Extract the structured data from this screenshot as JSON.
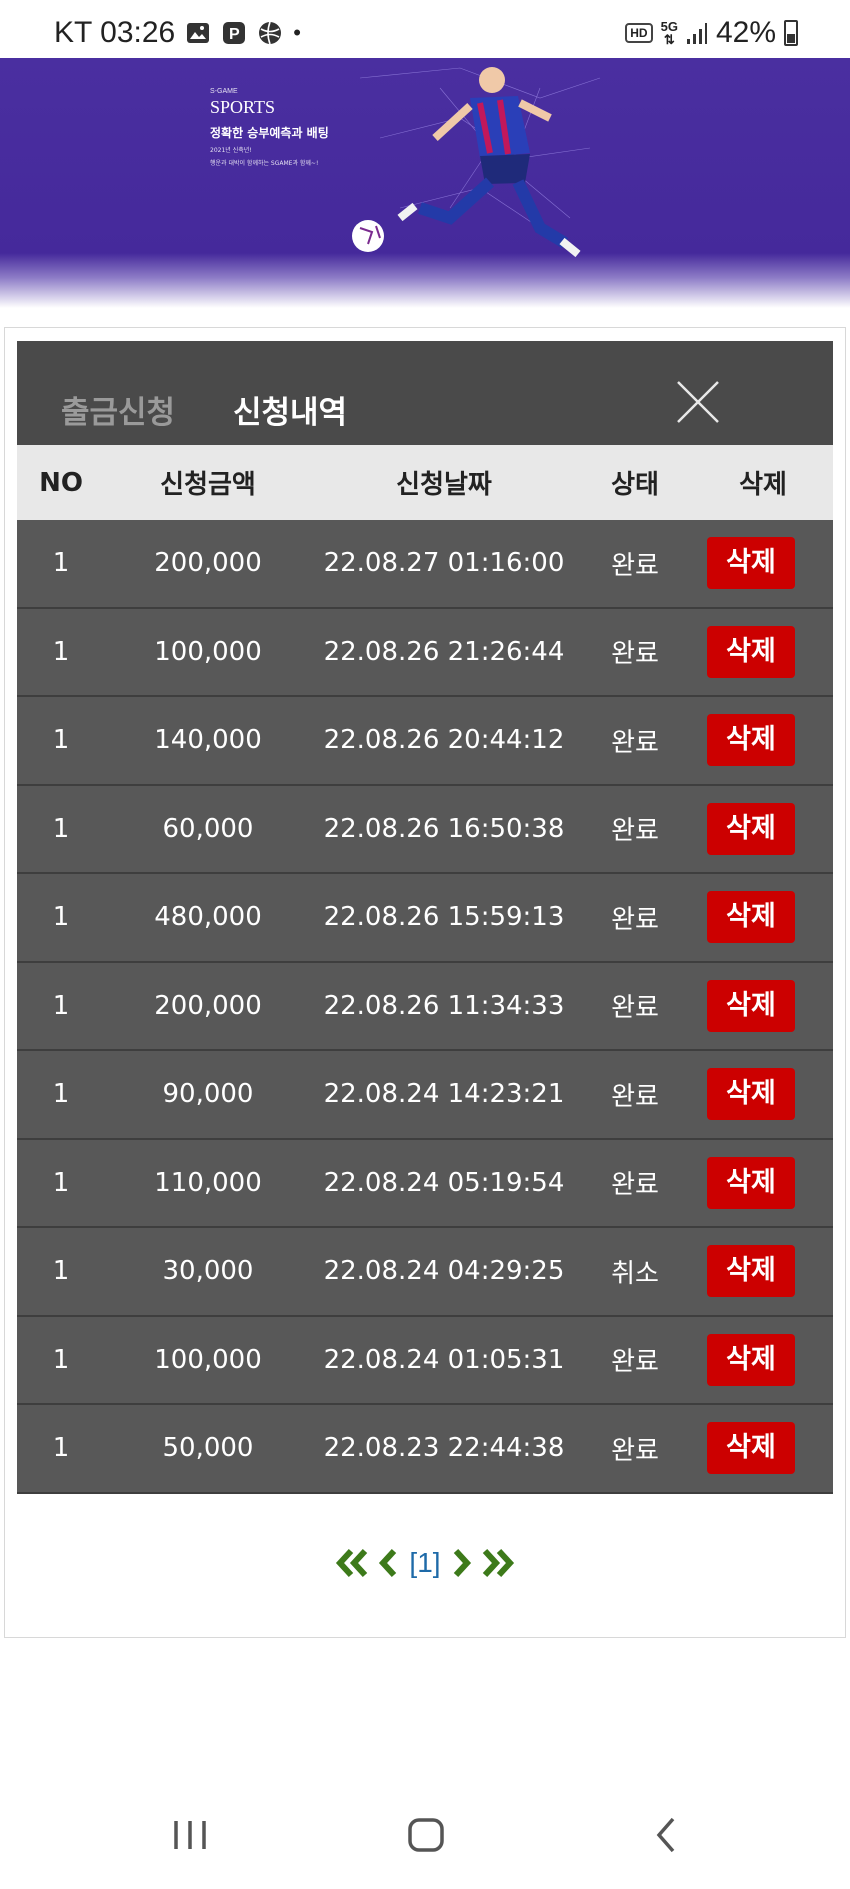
{
  "status_bar": {
    "carrier_time": "KT 03:26",
    "network": "5G",
    "hd_label": "HD",
    "battery_percent": "42%"
  },
  "banner": {
    "brand_small": "S-GAME",
    "title": "SPORTS",
    "headline": "정확한 승부예측과 배팅",
    "line1": "2021년 신축년!",
    "line2": "행운과 대박이 함께하는 SGAME과 함께~!"
  },
  "panel": {
    "tab_withdraw": "출금신청",
    "tab_history": "신청내역",
    "columns": {
      "no": "NO",
      "amount": "신청금액",
      "date": "신청날짜",
      "status": "상태",
      "delete": "삭제"
    },
    "rows": [
      {
        "no": "1",
        "amount": "200,000",
        "date": "22.08.27 01:16:00",
        "status": "완료",
        "delete": "삭제"
      },
      {
        "no": "1",
        "amount": "100,000",
        "date": "22.08.26 21:26:44",
        "status": "완료",
        "delete": "삭제"
      },
      {
        "no": "1",
        "amount": "140,000",
        "date": "22.08.26 20:44:12",
        "status": "완료",
        "delete": "삭제"
      },
      {
        "no": "1",
        "amount": "60,000",
        "date": "22.08.26 16:50:38",
        "status": "완료",
        "delete": "삭제"
      },
      {
        "no": "1",
        "amount": "480,000",
        "date": "22.08.26 15:59:13",
        "status": "완료",
        "delete": "삭제"
      },
      {
        "no": "1",
        "amount": "200,000",
        "date": "22.08.26 11:34:33",
        "status": "완료",
        "delete": "삭제"
      },
      {
        "no": "1",
        "amount": "90,000",
        "date": "22.08.24 14:23:21",
        "status": "완료",
        "delete": "삭제"
      },
      {
        "no": "1",
        "amount": "110,000",
        "date": "22.08.24 05:19:54",
        "status": "완료",
        "delete": "삭제"
      },
      {
        "no": "1",
        "amount": "30,000",
        "date": "22.08.24 04:29:25",
        "status": "취소",
        "delete": "삭제"
      },
      {
        "no": "1",
        "amount": "100,000",
        "date": "22.08.24 01:05:31",
        "status": "완료",
        "delete": "삭제"
      },
      {
        "no": "1",
        "amount": "50,000",
        "date": "22.08.23 22:44:38",
        "status": "완료",
        "delete": "삭제"
      }
    ]
  },
  "pagination": {
    "current": "[1]"
  },
  "colors": {
    "delete_button": "#cc0000",
    "header_bar": "#4a4a4a",
    "row_bg": "#585858",
    "pager_arrow": "#3d7a1a",
    "banner_bg": "#45299b"
  }
}
